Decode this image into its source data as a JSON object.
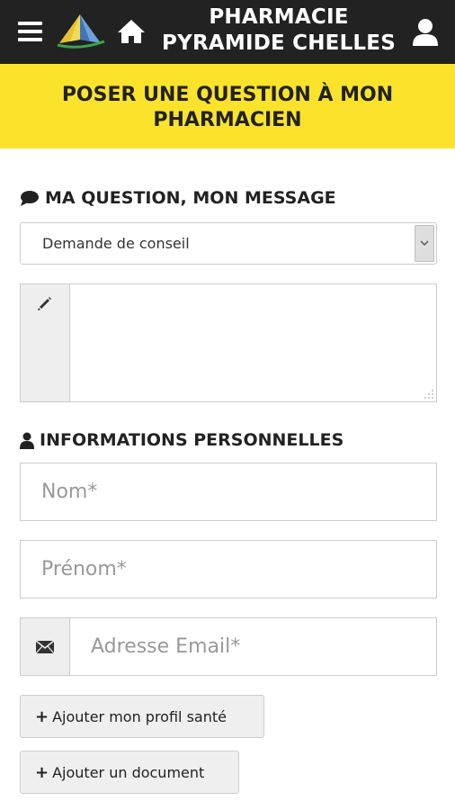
{
  "header": {
    "title_line1": "PHARMACIE",
    "title_line2": "PYRAMIDE CHELLES",
    "icons": [
      "hamburger-menu-icon",
      "pharmacy-logo",
      "home-icon",
      "user-account-icon"
    ]
  },
  "banner": {
    "line1": "POSER UNE QUESTION À MON",
    "line2": "PHARMACIEN",
    "background": "#fbe32b"
  },
  "question_section": {
    "title": "MA QUESTION, MON MESSAGE",
    "icon": "comment-icon",
    "select_value": "Demande de conseil",
    "message_icon": "pencil-icon",
    "message_value": ""
  },
  "personal_section": {
    "title": "INFORMATIONS PERSONNELLES",
    "icon": "user-icon",
    "nom_placeholder": "Nom*",
    "prenom_placeholder": "Prénom*",
    "email_placeholder": "Adresse Email*",
    "email_icon": "envelope-icon"
  },
  "buttons": {
    "profil": "Ajouter mon profil santé",
    "document": "Ajouter un document"
  },
  "colors": {
    "header_bg": "#222222",
    "banner_bg": "#fbe32b"
  }
}
